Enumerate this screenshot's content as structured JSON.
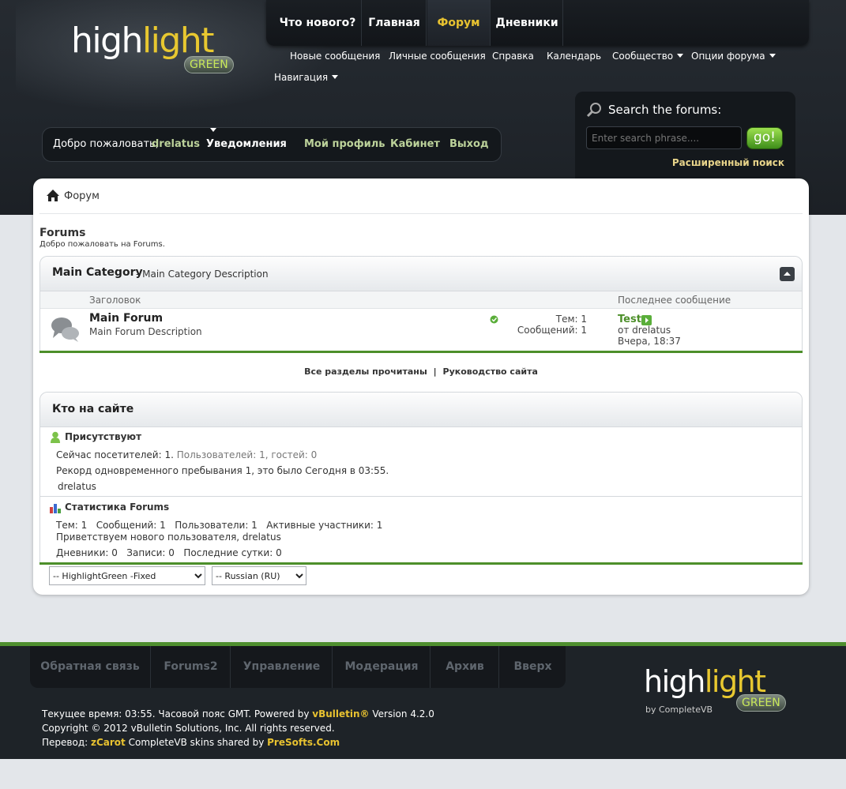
{
  "logo": {
    "a": "high",
    "b": "light",
    "badge": "GREEN"
  },
  "topnav": [
    "Что нового?",
    "Главная",
    "Форум",
    "Дневники"
  ],
  "subnav": [
    "Новые сообщения",
    "Личные сообщения",
    "Справка",
    "Календарь",
    "Сообщество",
    "Опции форума",
    "Навигация"
  ],
  "welcome": {
    "greeting": "Добро пожаловать,",
    "user": "drelatus",
    "notifications": "Уведомления",
    "profile": "Мой профиль",
    "cabinet": "Кабинет",
    "logout": "Выход"
  },
  "search": {
    "title": "Search the forums:",
    "placeholder": "Enter search phrase....",
    "go": "go!",
    "advanced": "Расширенный поиск"
  },
  "breadcrumb": "Форум",
  "page": {
    "title": "Forums",
    "subtitle": "Добро пожаловать на Forums."
  },
  "category": {
    "name": "Main Category",
    "desc": "- Main Category Description",
    "col_title": "Заголовок",
    "col_last": "Последнее сообщение"
  },
  "forum": {
    "name": "Main Forum",
    "desc": "Main Forum Description",
    "threads": "Тем: 1",
    "posts": "Сообщений: 1",
    "last_title": "Test",
    "last_by": "от drelatus",
    "last_time": "Вчера, 18:37"
  },
  "links": {
    "mark_read": "Все разделы прочитаны",
    "sep": "|",
    "guide": "Руководство сайта"
  },
  "online": {
    "title": "Кто на сайте",
    "present": "Присутствуют",
    "visitors_a": "Сейчас посетителей: 1.",
    "visitors_b": "Пользователей: 1, гостей: 0",
    "record": "Рекорд одновременного пребывания 1, это было Сегодня в 03:55.",
    "user": "drelatus"
  },
  "stats": {
    "title": "Статистика Forums",
    "line1": "Тем: 1   Сообщений: 1   Пользователи: 1   Активные участники: 1",
    "line2": "Приветствуем нового пользователя, drelatus",
    "line3": "Дневники: 0   Записи: 0   Последние сутки: 0"
  },
  "selects": {
    "style": "-- HighlightGreen -Fixed",
    "lang": "-- Russian (RU)"
  },
  "footnav": [
    "Обратная связь",
    "Forums2",
    "Управление",
    "Модерация",
    "Архив",
    "Вверх"
  ],
  "footer": {
    "time": "Текущее время: 03:55. Часовой пояс GMT. Powered by ",
    "vb": "vBulletin®",
    "version": " Version 4.2.0",
    "copyright": "Copyright © 2012 vBulletin Solutions, Inc. All rights reserved.",
    "trans": "Перевод: ",
    "zcarot": "zCarot",
    "skins": " CompleteVB skins shared by ",
    "presofts": "PreSofts.Com",
    "byline": "by CompleteVB"
  },
  "colors": {
    "accent": "#e8c230",
    "green": "#4d8f2a",
    "dark": "#1e2328"
  }
}
